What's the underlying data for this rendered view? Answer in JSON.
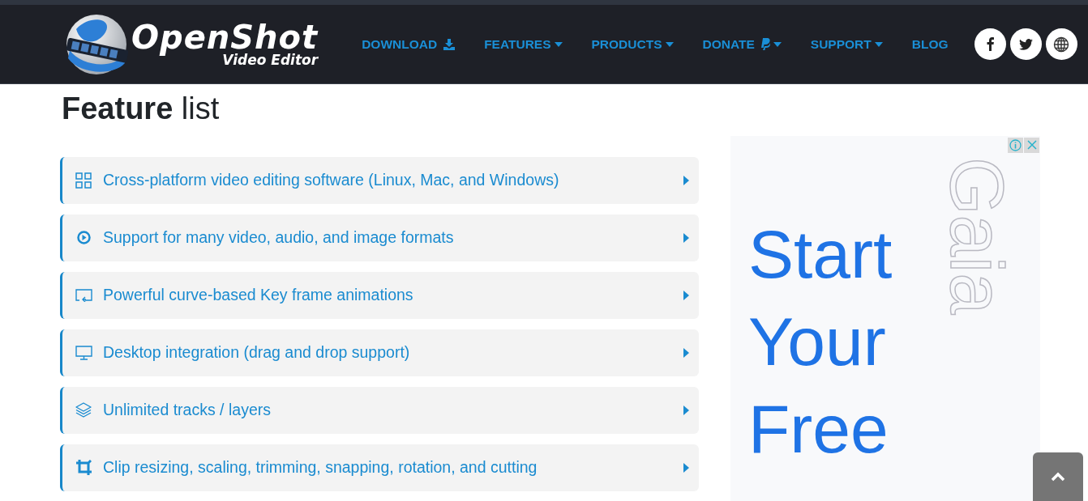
{
  "brand": {
    "name": "OpenShot",
    "tagline": "Video Editor"
  },
  "nav": [
    {
      "label": "DOWNLOAD",
      "kind": "download"
    },
    {
      "label": "FEATURES",
      "kind": "dropdown"
    },
    {
      "label": "PRODUCTS",
      "kind": "dropdown"
    },
    {
      "label": "DONATE",
      "kind": "donate"
    },
    {
      "label": "SUPPORT",
      "kind": "dropdown"
    },
    {
      "label": "BLOG",
      "kind": "plain"
    }
  ],
  "heading": "**Feature** list",
  "features": [
    {
      "label": "Cross-platform video editing software (Linux, Mac, and Windows)",
      "expanded": false
    },
    {
      "label": "Support for many video, audio, and image formats",
      "expanded": false
    },
    {
      "label": "Powerful curve-based Key frame animations",
      "expanded": false
    },
    {
      "label": "Desktop integration (drag and drop support)",
      "expanded": false
    },
    {
      "label": "Unlimited tracks / layers",
      "expanded": false
    },
    {
      "label": "Clip resizing, scaling, trimming, snapping, rotation, and cutting",
      "expanded": false
    }
  ],
  "ad": {
    "headline": [
      "Start",
      "Your",
      "Free"
    ],
    "logo_text": "Gaia"
  }
}
